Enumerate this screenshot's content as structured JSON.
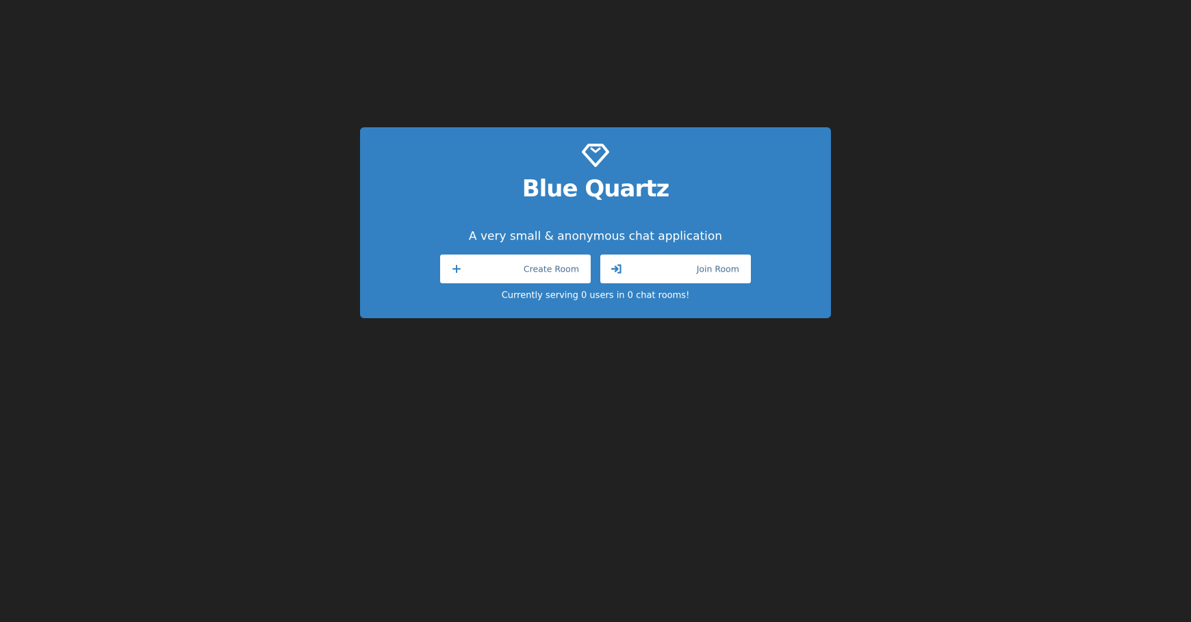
{
  "app": {
    "title": "Blue Quartz",
    "tagline": "A very small & anonymous chat application",
    "logo_icon": "gem-icon"
  },
  "actions": {
    "create": {
      "label": "Create Room",
      "icon": "plus-icon"
    },
    "join": {
      "label": "Join Room",
      "icon": "sign-in-icon"
    }
  },
  "stats": {
    "text": "Currently serving 0 users in 0 chat rooms!"
  },
  "colors": {
    "background": "#212121",
    "card": "#3381c2",
    "button": "#ffffff",
    "button_text": "#4a6e8e",
    "icon": "#3381c2"
  }
}
